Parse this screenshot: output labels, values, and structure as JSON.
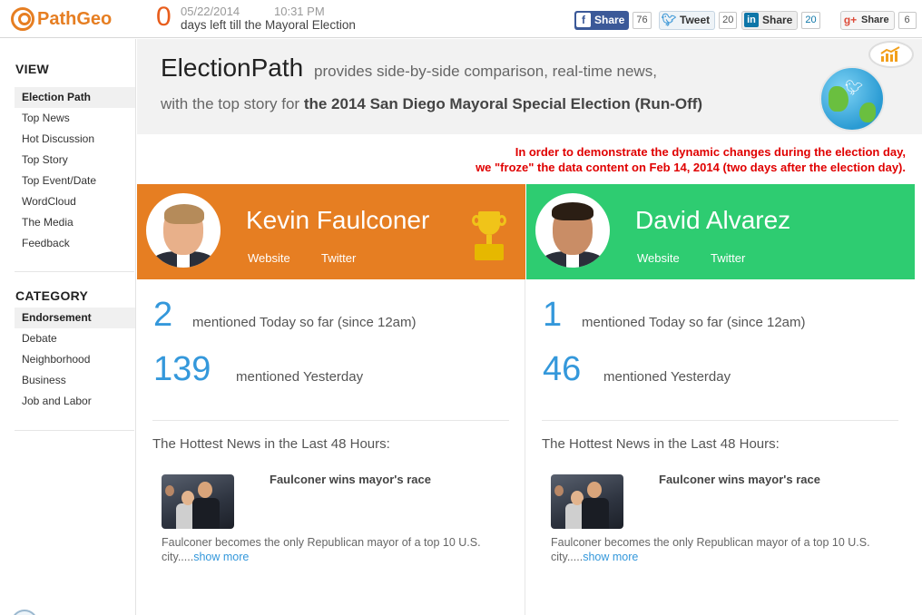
{
  "brand": {
    "name": "PathGeo"
  },
  "countdown": {
    "days": "0",
    "date": "05/22/2014",
    "time": "10:31 PM",
    "text": "days left till the Mayoral Election"
  },
  "social": [
    {
      "label": "Share",
      "count": "76",
      "network": "facebook"
    },
    {
      "label": "Tweet",
      "count": "20",
      "network": "twitter"
    },
    {
      "label": "Share",
      "count": "20",
      "network": "linkedin"
    },
    {
      "label": "Share",
      "count": "6",
      "network": "google-plus"
    }
  ],
  "sidebar": {
    "view_heading": "VIEW",
    "view_items": [
      "Election Path",
      "Top News",
      "Hot Discussion",
      "Top Story",
      "Top Event/Date",
      "WordCloud",
      "The Media",
      "Feedback"
    ],
    "category_heading": "CATEGORY",
    "category_items": [
      "Endorsement",
      "Debate",
      "Neighborhood",
      "Business",
      "Job and Labor"
    ]
  },
  "banner": {
    "title": "ElectionPath",
    "subtitle": "provides side-by-side comparison, real-time news,",
    "line2_prefix": "with the top story for",
    "line2_bold": "the 2014 San Diego Mayoral Special Election (Run-Off)"
  },
  "notice": {
    "line1": "In order to demonstrate the dynamic changes during the election day,",
    "line2": "we \"froze\" the data content on Feb 14, 2014 (two days after the election day)."
  },
  "candidates": [
    {
      "name": "Kevin Faulconer",
      "website_label": "Website",
      "twitter_label": "Twitter",
      "today_count": "2",
      "today_label": "mentioned Today so far (since 12am)",
      "yesterday_count": "139",
      "yesterday_label": "mentioned Yesterday",
      "hot_title": "The Hottest News in the Last 48 Hours:",
      "news_headline": "Faulconer wins mayor's race",
      "news_desc": "Faulconer becomes the only Republican mayor of a top 10 U.S. city.....",
      "news_more": "show more",
      "color": "#e67e22"
    },
    {
      "name": "David Alvarez",
      "website_label": "Website",
      "twitter_label": "Twitter",
      "today_count": "1",
      "today_label": "mentioned Today so far (since 12am)",
      "yesterday_count": "46",
      "yesterday_label": "mentioned Yesterday",
      "hot_title": "The Hottest News in the Last 48 Hours:",
      "news_headline": "Faulconer wins mayor's race",
      "news_desc": "Faulconer becomes the only Republican mayor of a top 10 U.S. city.....",
      "news_more": "show more",
      "color": "#2ecc71"
    }
  ],
  "colors": {
    "accent": "#e67e22",
    "link": "#3498db",
    "notice": "#e00000"
  }
}
